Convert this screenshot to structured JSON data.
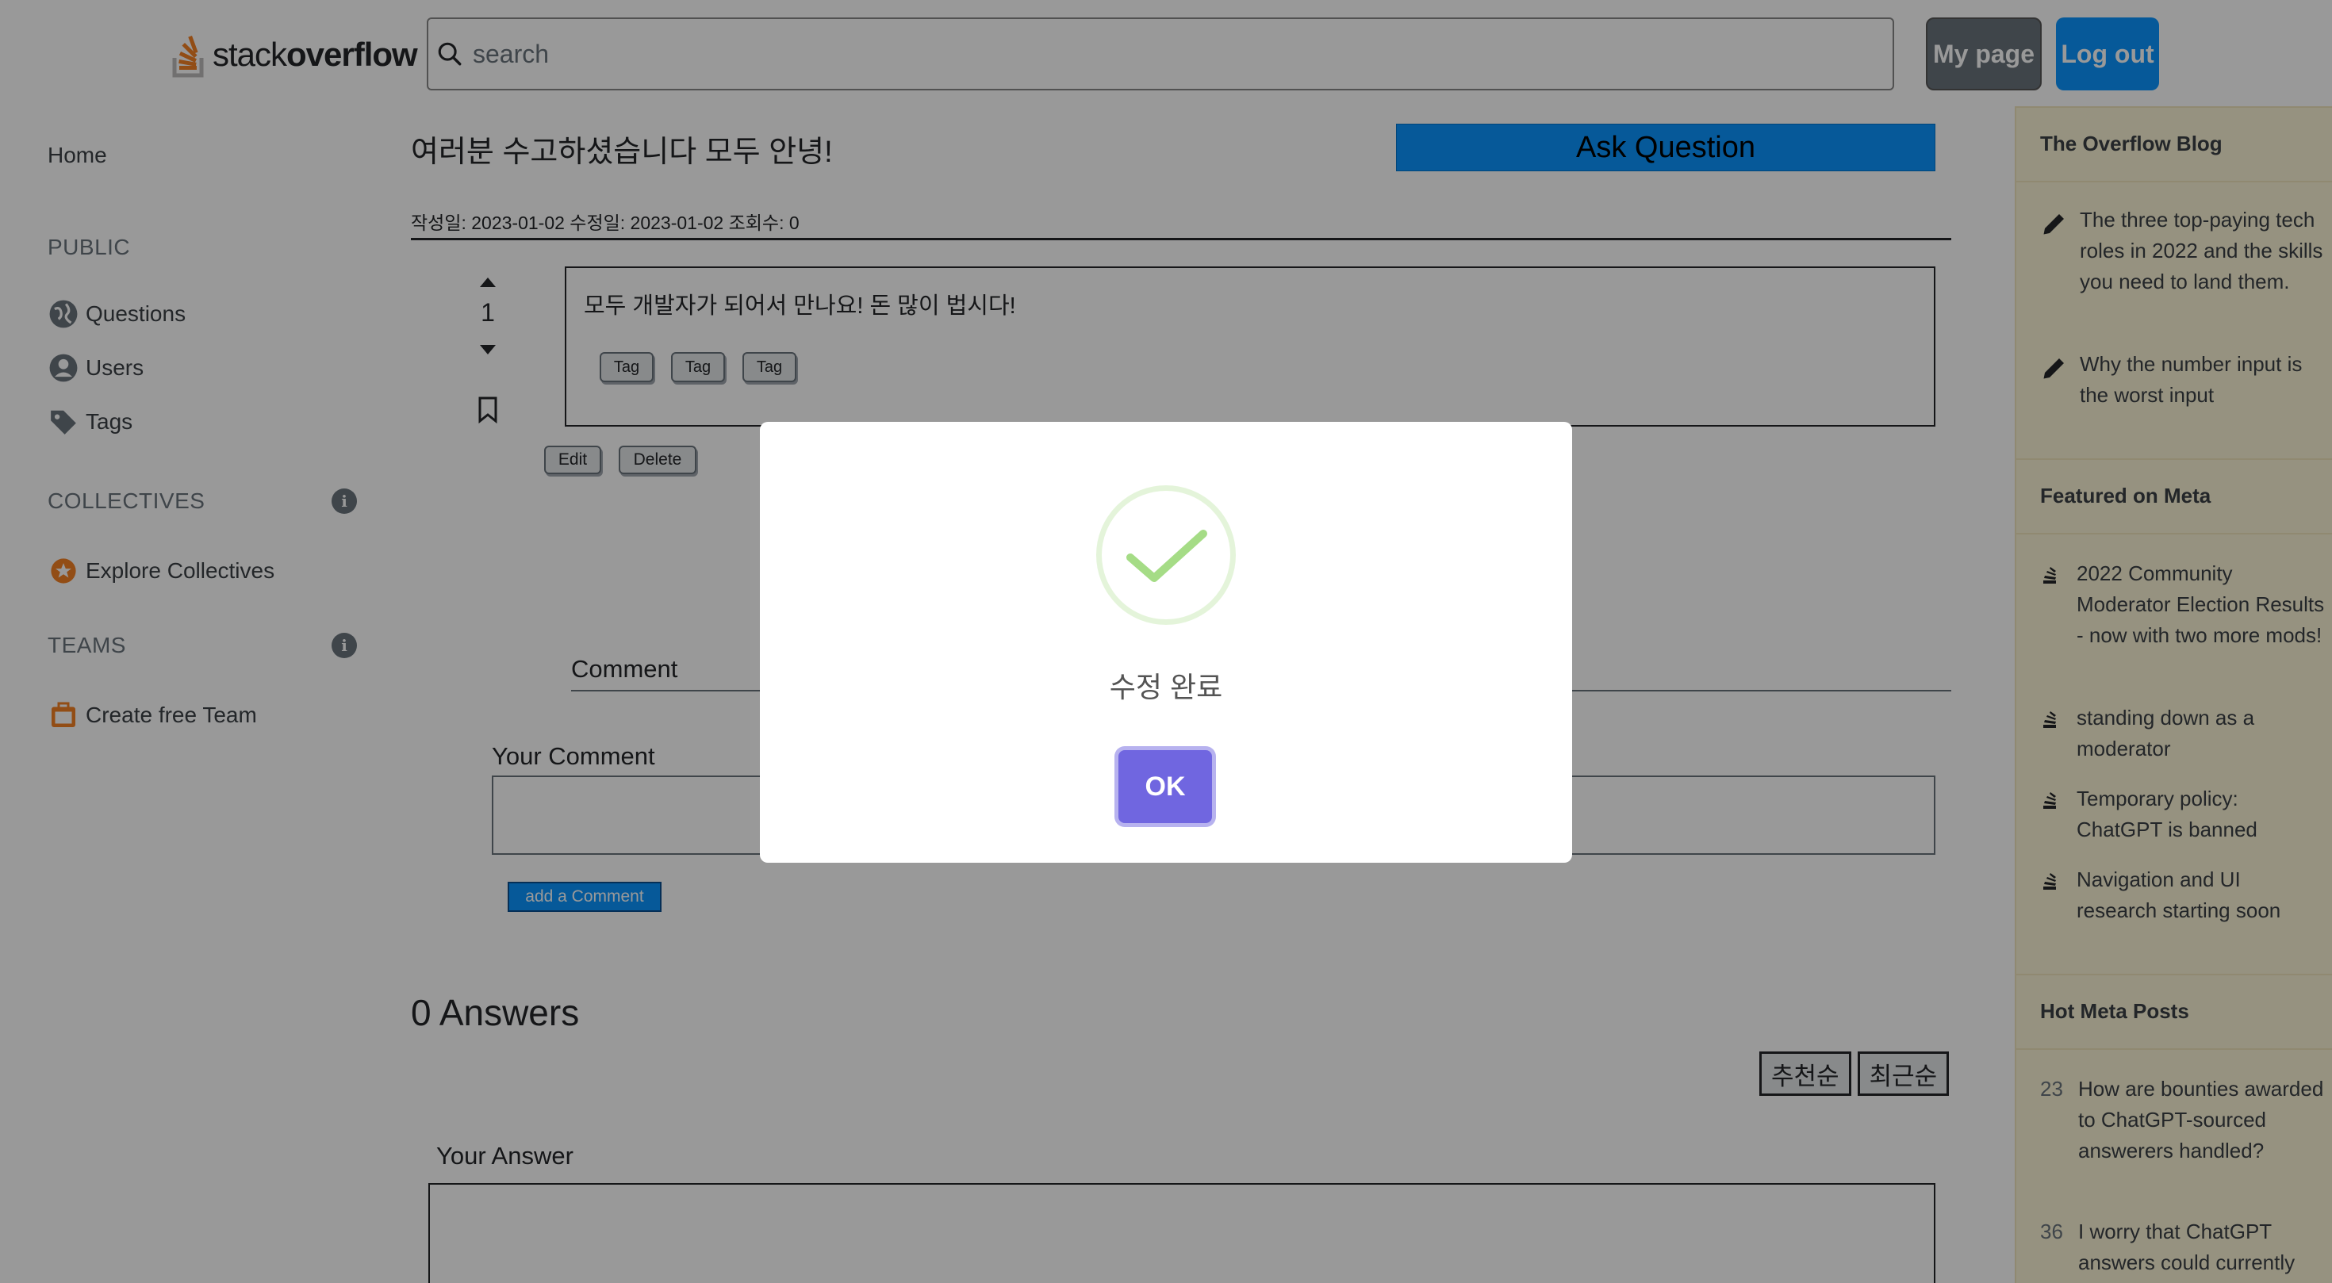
{
  "header": {
    "logo_light": "stack",
    "logo_bold": "overflow",
    "search_placeholder": "search",
    "mypage_label": "My page",
    "logout_label": "Log out"
  },
  "leftnav": {
    "home": "Home",
    "public_heading": "PUBLIC",
    "questions": "Questions",
    "users": "Users",
    "tags": "Tags",
    "collectives_heading": "COLLECTIVES",
    "explore_collectives": "Explore Collectives",
    "teams_heading": "TEAMS",
    "create_team": "Create free Team",
    "info_glyph": "i"
  },
  "question": {
    "title": "여러분 수고하셨습니다 모두 안녕!",
    "ask_label": "Ask Question",
    "meta": "작성일: 2023-01-02 수정일: 2023-01-02 조회수: 0",
    "votes": "1",
    "body": "모두 개발자가 되어서 만나요! 돈 많이 법시다!",
    "tags": [
      "Tag",
      "Tag",
      "Tag"
    ],
    "edit_label": "Edit",
    "delete_label": "Delete"
  },
  "comments": {
    "heading": "Comment",
    "your_comment": "Your Comment",
    "add_label": "add a Comment"
  },
  "answers": {
    "count_label": "0 Answers",
    "sort_recommended": "추천순",
    "sort_recent": "최근순",
    "your_answer": "Your Answer"
  },
  "rightbar": {
    "blog_heading": "The Overflow Blog",
    "blog_items": [
      "The three top-paying tech roles in 2022 and the skills you need to land them.",
      "Why the number input is the worst input"
    ],
    "meta_heading": "Featured on Meta",
    "meta_items": [
      "2022 Community Moderator Election Results - now with two more mods!",
      "standing down as a moderator",
      "Temporary policy: ChatGPT is banned",
      "Navigation and UI research starting soon"
    ],
    "hot_heading": "Hot Meta Posts",
    "hot_items": [
      {
        "num": "23",
        "text": "How are bounties awarded to ChatGPT-sourced answerers handled?"
      },
      {
        "num": "36",
        "text": "I worry that ChatGPT answers could currently"
      }
    ]
  },
  "modal": {
    "title": "수정 완료",
    "ok_label": "OK",
    "accent": "#7066e0",
    "success_color": "#a5dc86"
  }
}
